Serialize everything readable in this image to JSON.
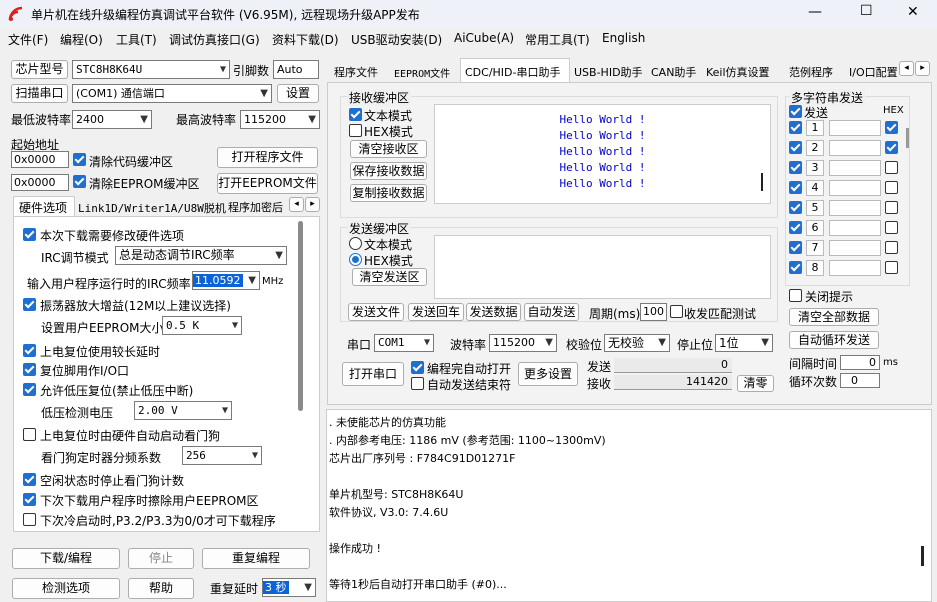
{
  "window": {
    "title": "单片机在线升级编程仿真调试平台软件 (V6.95M), 远程现场升级APP发布",
    "min": "—",
    "max": "☐",
    "close": "✕"
  },
  "menu": [
    "文件(F)",
    "编程(O)",
    "工具(T)",
    "调试仿真接口(G)",
    "资料下载(D)",
    "USB驱动安装(D)",
    "AiCube(A)",
    "常用工具(T)",
    "English"
  ],
  "left": {
    "chip_label": "芯片型号",
    "chip_value": "STC8H8K64U",
    "pins_label": "引脚数",
    "pins_value": "Auto",
    "scan_label": "扫描串口",
    "port_value": "(COM1) 通信端口",
    "settings_label": "设置",
    "minbaud_label": "最低波特率",
    "minbaud_value": "2400",
    "maxbaud_label": "最高波特率",
    "maxbaud_value": "115200",
    "start_label": "起始地址",
    "addr1": "0x0000",
    "clear_code": "清除代码缓冲区",
    "open_prog": "打开程序文件",
    "addr2": "0x0000",
    "clear_eeprom": "清除EEPROM缓冲区",
    "open_eeprom": "打开EEPROM文件",
    "tabs": [
      "硬件选项",
      "Link1D/Writer1A/U8W脱机",
      "程序加密后"
    ],
    "tab_arrows": [
      "◂",
      "▸"
    ],
    "opts": {
      "o1": "本次下载需要修改硬件选项",
      "irc_label": "IRC调节模式",
      "irc_value": "总是动态调节IRC频率",
      "freq_label": "输入用户程序运行时的IRC频率",
      "freq_value": "11.0592",
      "freq_unit": "MHz",
      "o2": "振荡器放大增益(12M以上建议选择)",
      "eeprom_label": "设置用户EEPROM大小",
      "eeprom_value": "0.5 K",
      "o3": "上电复位使用较长延时",
      "o4": "复位脚用作I/O口",
      "o5": "允许低压复位(禁止低压中断)",
      "lv_label": "低压检测电压",
      "lv_value": "2.00 V",
      "o6": "上电复位时由硬件自动启动看门狗",
      "wd_label": "看门狗定时器分频系数",
      "wd_value": "256",
      "o7": "空闲状态时停止看门狗计数",
      "o8": "下次下载用户程序时擦除用户EEPROM区",
      "o9": "下次冷启动时,P3.2/P3.3为0/0才可下载程序"
    },
    "download": "下载/编程",
    "stop": "停止",
    "reprogram": "重复编程",
    "check": "检测选项",
    "help": "帮助",
    "delay_label": "重复延时",
    "delay_value": "3 秒"
  },
  "right": {
    "tabs": [
      "程序文件",
      "EEPROM文件",
      "CDC/HID-串口助手",
      "USB-HID助手",
      "CAN助手",
      "Keil仿真设置",
      "范例程序",
      "I/O口配置"
    ],
    "rx_title": "接收缓冲区",
    "text_mode": "文本模式",
    "hex_mode": "HEX模式",
    "clear_rx": "清空接收区",
    "save_rx": "保存接收数据",
    "copy_rx": "复制接收数据",
    "rx_lines": [
      "Hello World !",
      "Hello World !",
      "Hello World !",
      "Hello World !",
      "Hello World !"
    ],
    "tx_title": "发送缓冲区",
    "tx_text_mode": "文本模式",
    "tx_hex_mode": "HEX模式",
    "clear_tx": "清空发送区",
    "send_file": "发送文件",
    "send_return": "发送回车",
    "send_data": "发送数据",
    "auto_send": "自动发送",
    "period_label": "周期(ms)",
    "period_value": "100",
    "match_test": "收发匹配测试",
    "port_label": "串口",
    "port_value": "COM1",
    "baud_label": "波特率",
    "baud_value": "115200",
    "parity_label": "校验位",
    "parity_value": "无校验",
    "stop_label": "停止位",
    "stop_value": "1位",
    "open_port": "打开串口",
    "auto_open": "编程完自动打开",
    "auto_close": "自动发送结束符",
    "more": "更多设置",
    "tx_count_label": "发送",
    "tx_count": "0",
    "rx_count_label": "接收",
    "rx_count": "141420",
    "clear_count": "清零",
    "multi": {
      "title": "多字符串发送",
      "send_label": "发送",
      "hex_label": "HEX",
      "rows": [
        "1",
        "2",
        "3",
        "4",
        "5",
        "6",
        "7",
        "8"
      ],
      "close_hint": "关闭提示",
      "clear_all": "清空全部数据",
      "auto_loop": "自动循环发送",
      "interval_label": "间隔时间",
      "interval_value": "0",
      "interval_unit": "ms",
      "loops_label": "循环次数",
      "loops_value": "0"
    },
    "log": [
      ". 未使能芯片的仿真功能",
      ". 内部参考电压: 1186 mV (参考范围: 1100~1300mV)",
      "芯片出厂序列号 : F784C91D01271F",
      "",
      "  单片机型号: STC8H8K64U",
      "  软件协议, V3.0: 7.4.6U",
      "",
      "操作成功 !",
      "",
      "等待1秒后自动打开串口助手 (#0)..."
    ]
  }
}
